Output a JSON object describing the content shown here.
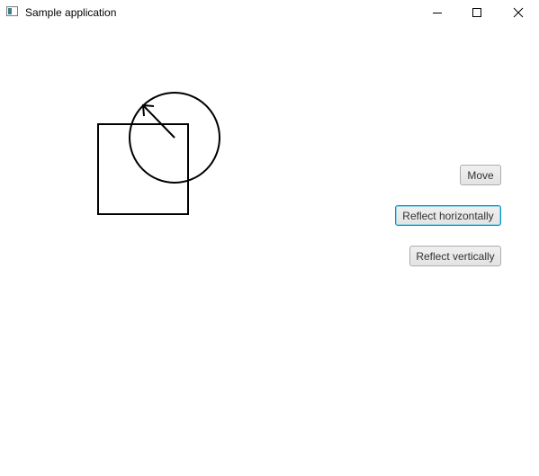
{
  "window": {
    "title": "Sample application",
    "icon": "app-window-icon",
    "controls": {
      "minimize_icon": "minimize-icon",
      "maximize_icon": "maximize-icon",
      "close_icon": "close-icon"
    }
  },
  "canvas": {
    "shapes": [
      "square",
      "circle",
      "arrow"
    ],
    "stroke_color": "#000000"
  },
  "actions": {
    "move_label": "Move",
    "reflect_horizontally_label": "Reflect horizontally",
    "reflect_vertically_label": "Reflect vertically",
    "focused": "Reflect horizontally"
  },
  "colors": {
    "focus_border": "#0096c9",
    "button_border": "#acacac",
    "background": "#ffffff"
  }
}
